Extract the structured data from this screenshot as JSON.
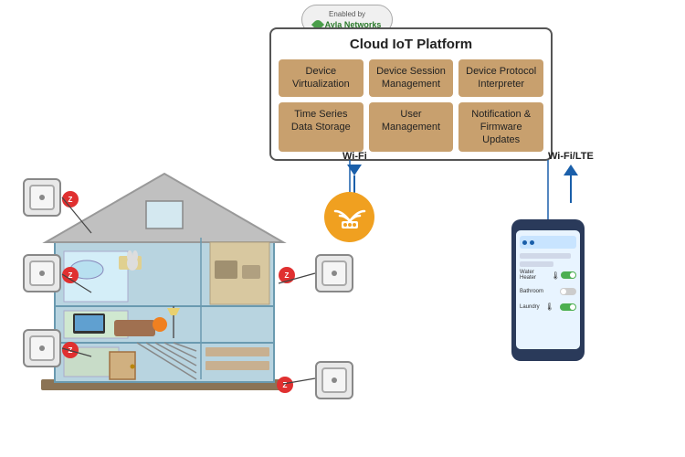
{
  "cloud": {
    "enabled_by": "Enabled by",
    "ayla_name": "Ayla Networks",
    "platform_title": "Cloud IoT Platform",
    "cells": [
      {
        "label": "Device\nVirtualization"
      },
      {
        "label": "Device Session\nManagement"
      },
      {
        "label": "Device Protocol\nInterpreter"
      },
      {
        "label": "Time Series\nData Storage"
      },
      {
        "label": "User\nManagement"
      },
      {
        "label": "Notification &\nFirmware Updates"
      }
    ]
  },
  "wifi_label": "Wi-Fi",
  "wifi_lte_label": "Wi-Fi/LTE",
  "phone_rows": [
    {
      "label": "Water Heater",
      "on": true
    },
    {
      "label": "Bathroom",
      "on": false
    },
    {
      "label": "Laundry",
      "on": true
    }
  ]
}
